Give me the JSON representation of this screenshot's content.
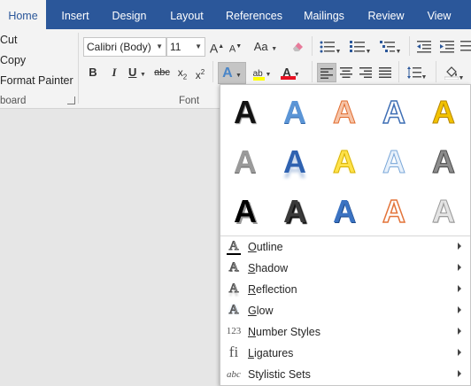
{
  "tabs": [
    {
      "label": "Home",
      "active": true
    },
    {
      "label": "Insert",
      "active": false
    },
    {
      "label": "Design",
      "active": false
    },
    {
      "label": "Layout",
      "active": false
    },
    {
      "label": "References",
      "active": false
    },
    {
      "label": "Mailings",
      "active": false
    },
    {
      "label": "Review",
      "active": false
    },
    {
      "label": "View",
      "active": false
    }
  ],
  "clipboard": {
    "cut": "Cut",
    "copy": "Copy",
    "format_painter": "Format Painter",
    "group_label": "board"
  },
  "font": {
    "font_name": "Calibri (Body)",
    "font_size": "11",
    "grow_label": "A",
    "shrink_label": "A",
    "change_case_label": "Aa",
    "bold": "B",
    "italic": "I",
    "underline": "U",
    "strikethrough": "abc",
    "subscript_base": "x",
    "subscript_mark": "2",
    "superscript_base": "x",
    "superscript_mark": "2",
    "text_effects_label": "A",
    "highlight_label": "ab",
    "font_color_label": "A",
    "group_label": "Font",
    "highlight_color": "#ffff00",
    "font_color": "#e81123"
  },
  "colors": {
    "tab_bar": "#2b579a",
    "ribbon": "#f3f3f3",
    "document_bg": "#e6e6e6"
  },
  "text_effects_gallery": [
    [
      {
        "glyph": "A",
        "style": "black-fill"
      },
      {
        "glyph": "A",
        "style": "blue-gradient"
      },
      {
        "glyph": "A",
        "style": "orange-outline"
      },
      {
        "glyph": "A",
        "style": "blue-outline"
      },
      {
        "glyph": "A",
        "style": "gold-fill"
      }
    ],
    [
      {
        "glyph": "A",
        "style": "gray-gradient"
      },
      {
        "glyph": "A",
        "style": "blue-reflection"
      },
      {
        "glyph": "A",
        "style": "yellow-glow"
      },
      {
        "glyph": "A",
        "style": "light-blue-outline"
      },
      {
        "glyph": "A",
        "style": "gray-bevel"
      }
    ],
    [
      {
        "glyph": "A",
        "style": "black-shadow"
      },
      {
        "glyph": "A",
        "style": "dark-shadow"
      },
      {
        "glyph": "A",
        "style": "blue-bevel"
      },
      {
        "glyph": "A",
        "style": "orange-white"
      },
      {
        "glyph": "A",
        "style": "silver"
      }
    ]
  ],
  "text_effects_menu": [
    {
      "key": "outline",
      "icon": "A",
      "mnemonic": "O",
      "rest": "utline"
    },
    {
      "key": "shadow",
      "icon": "A",
      "mnemonic": "S",
      "rest": "hadow"
    },
    {
      "key": "reflection",
      "icon": "A",
      "mnemonic": "R",
      "rest": "eflection"
    },
    {
      "key": "glow",
      "icon": "A",
      "mnemonic": "G",
      "rest": "low"
    },
    {
      "key": "number-styles",
      "icon": "123",
      "mnemonic": "N",
      "rest": "umber Styles"
    },
    {
      "key": "ligatures",
      "icon": "fi",
      "mnemonic": "L",
      "rest": "igatures"
    },
    {
      "key": "stylistic-sets",
      "icon": "abc",
      "mnemonic": "",
      "rest": "Stylistic Sets"
    }
  ]
}
